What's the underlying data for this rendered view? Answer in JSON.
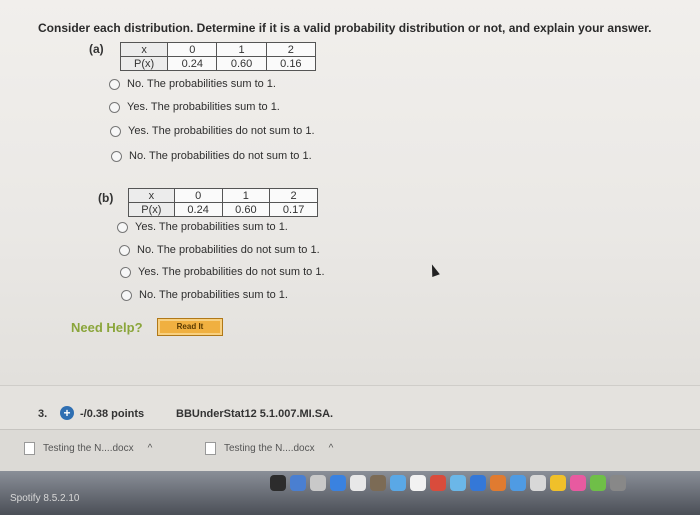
{
  "instruction": "Consider each distribution. Determine if it is a valid probability distribution or not, and explain your answer.",
  "part_a": {
    "label": "(a)",
    "header": [
      "x",
      "0",
      "1",
      "2"
    ],
    "row": [
      "P(x)",
      "0.24",
      "0.60",
      "0.16"
    ],
    "options": [
      "No. The probabilities sum to 1.",
      "Yes. The probabilities sum to 1.",
      "Yes. The probabilities do not sum to 1.",
      "No. The probabilities do not sum to 1."
    ]
  },
  "part_b": {
    "label": "(b)",
    "header": [
      "x",
      "0",
      "1",
      "2"
    ],
    "row": [
      "P(x)",
      "0.24",
      "0.60",
      "0.17"
    ],
    "options": [
      "Yes. The probabilities sum to 1.",
      "No. The probabilities do not sum to 1.",
      "Yes. The probabilities do not sum to 1.",
      "No. The probabilities sum to 1."
    ]
  },
  "help": {
    "label": "Need Help?",
    "read_it": "Read It"
  },
  "next_question": {
    "number": "3.",
    "points": "-/0.38 points",
    "id": "BBUnderStat12 5.1.007.MI.SA."
  },
  "downloads": [
    "Testing the N....docx",
    "Testing the N....docx"
  ],
  "dock": {
    "app_label": "Spotify 8.5.2.10"
  },
  "colors": {
    "help_green": "#8aa53b",
    "read_it_orange": "#f0b040",
    "plus_blue": "#2f6fb2"
  }
}
